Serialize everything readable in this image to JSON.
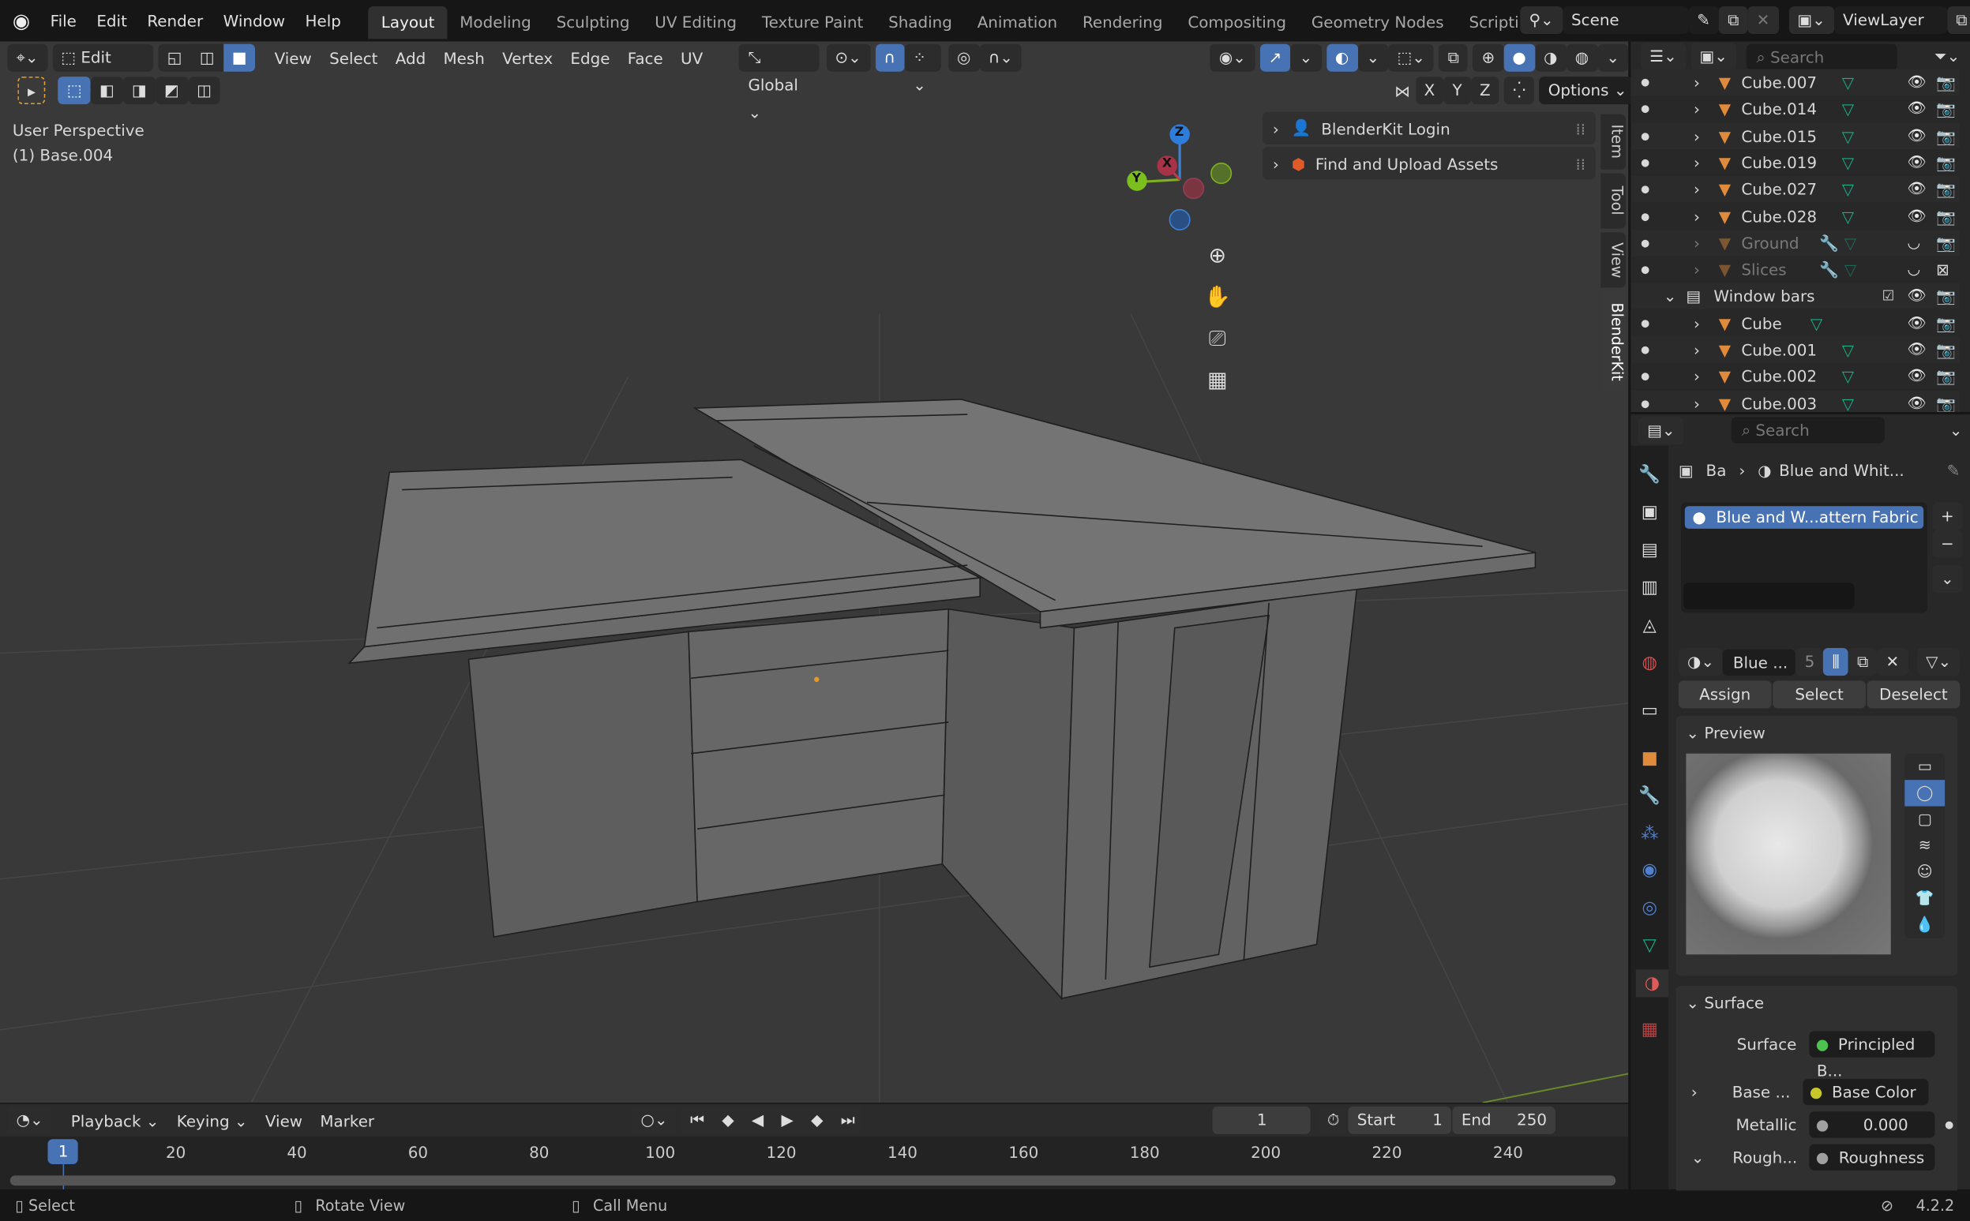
{
  "app": {
    "version": "4.2.2"
  },
  "topbar": {
    "menus": [
      "File",
      "Edit",
      "Render",
      "Window",
      "Help"
    ],
    "workspaces": [
      "Layout",
      "Modeling",
      "Sculpting",
      "UV Editing",
      "Texture Paint",
      "Shading",
      "Animation",
      "Rendering",
      "Compositing",
      "Geometry Nodes",
      "Scripting"
    ],
    "active_workspace": "Layout",
    "add_workspace": "+",
    "scene": "Scene",
    "view_layer": "ViewLayer"
  },
  "viewport_header": {
    "mode": "Edit Mode",
    "menus": [
      "View",
      "Select",
      "Add",
      "Mesh",
      "Vertex",
      "Edge",
      "Face",
      "UV"
    ],
    "transform_orientation": "Global",
    "mirror_axes": [
      "X",
      "Y",
      "Z"
    ],
    "options_label": "Options"
  },
  "viewport": {
    "perspective": "User Perspective",
    "object": "(1) Base.004",
    "gizmo_axes": [
      "X",
      "Y",
      "Z"
    ],
    "blenderkit": [
      "BlenderKit Login",
      "Find and Upload Assets"
    ],
    "sidebar_tabs": [
      "Item",
      "Tool",
      "View",
      "BlenderKit"
    ]
  },
  "outliner": {
    "search_placeholder": "Search",
    "rows": [
      {
        "name": "Cube.007",
        "dim": false,
        "type": "object"
      },
      {
        "name": "Cube.014",
        "dim": false,
        "type": "object"
      },
      {
        "name": "Cube.015",
        "dim": false,
        "type": "object"
      },
      {
        "name": "Cube.019",
        "dim": false,
        "type": "object"
      },
      {
        "name": "Cube.027",
        "dim": false,
        "type": "object"
      },
      {
        "name": "Cube.028",
        "dim": false,
        "type": "object"
      },
      {
        "name": "Ground",
        "dim": true,
        "type": "object"
      },
      {
        "name": "Slices",
        "dim": true,
        "type": "object"
      },
      {
        "name": "Window bars",
        "dim": false,
        "type": "collection"
      },
      {
        "name": "Cube",
        "dim": false,
        "type": "object"
      },
      {
        "name": "Cube.001",
        "dim": false,
        "type": "object"
      },
      {
        "name": "Cube.002",
        "dim": false,
        "type": "object"
      },
      {
        "name": "Cube.003",
        "dim": false,
        "type": "object"
      }
    ]
  },
  "properties": {
    "search_placeholder": "Search",
    "breadcrumb_object": "Ba",
    "breadcrumb_material": "Blue and Whit...",
    "material_slot": "Blue and W...attern Fabric",
    "material_name": "Blue ...",
    "user_count": "5",
    "buttons": {
      "assign": "Assign",
      "select": "Select",
      "deselect": "Deselect"
    },
    "preview_title": "Preview",
    "surface_title": "Surface",
    "surface": {
      "surface_label": "Surface",
      "surface_value": "Principled B...",
      "base_label": "Base ...",
      "base_value": "Base Color",
      "metallic_label": "Metallic",
      "metallic_value": "0.000",
      "rough_label": "Rough...",
      "rough_value": "Roughness"
    },
    "colors": {
      "surface_socket": "#4ec24e",
      "base_socket": "#c7c729",
      "grey_socket": "#a0a0a0",
      "accent": "#4772b3"
    }
  },
  "timeline": {
    "menus": {
      "playback": "Playback",
      "keying": "Keying",
      "view": "View",
      "marker": "Marker"
    },
    "current_frame": "1",
    "start_label": "Start",
    "start": "1",
    "end_label": "End",
    "end": "250",
    "ticks": [
      "20",
      "40",
      "60",
      "80",
      "100",
      "120",
      "140",
      "160",
      "180",
      "200",
      "220",
      "240"
    ],
    "playhead": "1"
  },
  "status": {
    "select": "Select",
    "rotate": "Rotate View",
    "menu": "Call Menu",
    "version": "4.2.2"
  }
}
